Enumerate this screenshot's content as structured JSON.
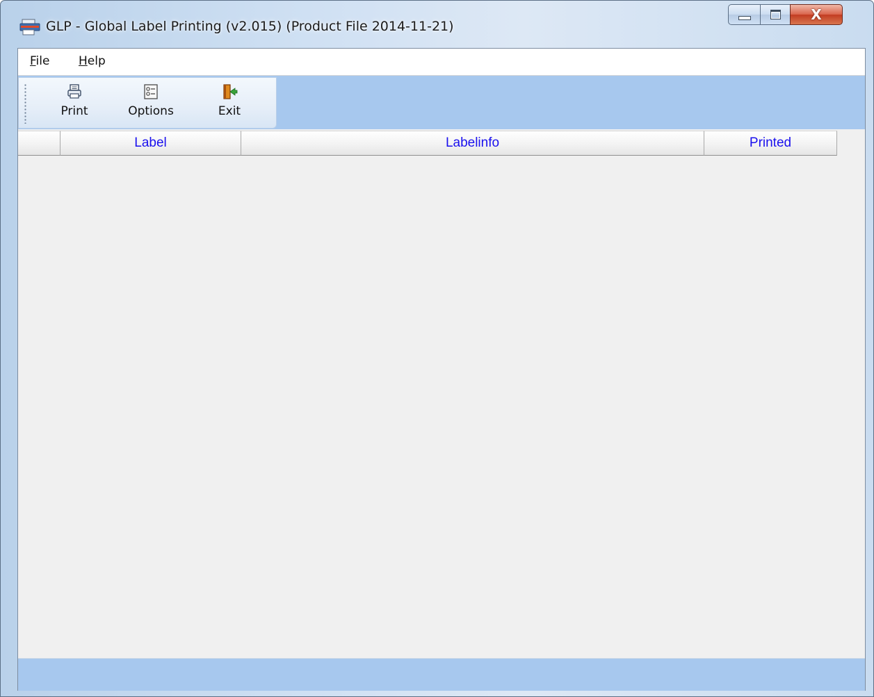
{
  "window": {
    "title": "GLP - Global Label Printing (v2.015) (Product File 2014-11-21)",
    "close_glyph": "X"
  },
  "menu": {
    "items": [
      {
        "label": "File",
        "accel": "F",
        "rest": "ile"
      },
      {
        "label": "Help",
        "accel": "H",
        "rest": "elp"
      }
    ]
  },
  "toolbar": {
    "buttons": [
      {
        "label": "Print",
        "icon": "printer-icon"
      },
      {
        "label": "Options",
        "icon": "options-icon"
      },
      {
        "label": "Exit",
        "icon": "exit-door-icon"
      }
    ]
  },
  "grid": {
    "columns": [
      "",
      "Label",
      "Labelinfo",
      "Printed"
    ],
    "rows": []
  },
  "colors": {
    "header_text": "#1a10ee",
    "toolbar_band": "#a7c8ee",
    "client_bg": "#f0f0f0"
  }
}
